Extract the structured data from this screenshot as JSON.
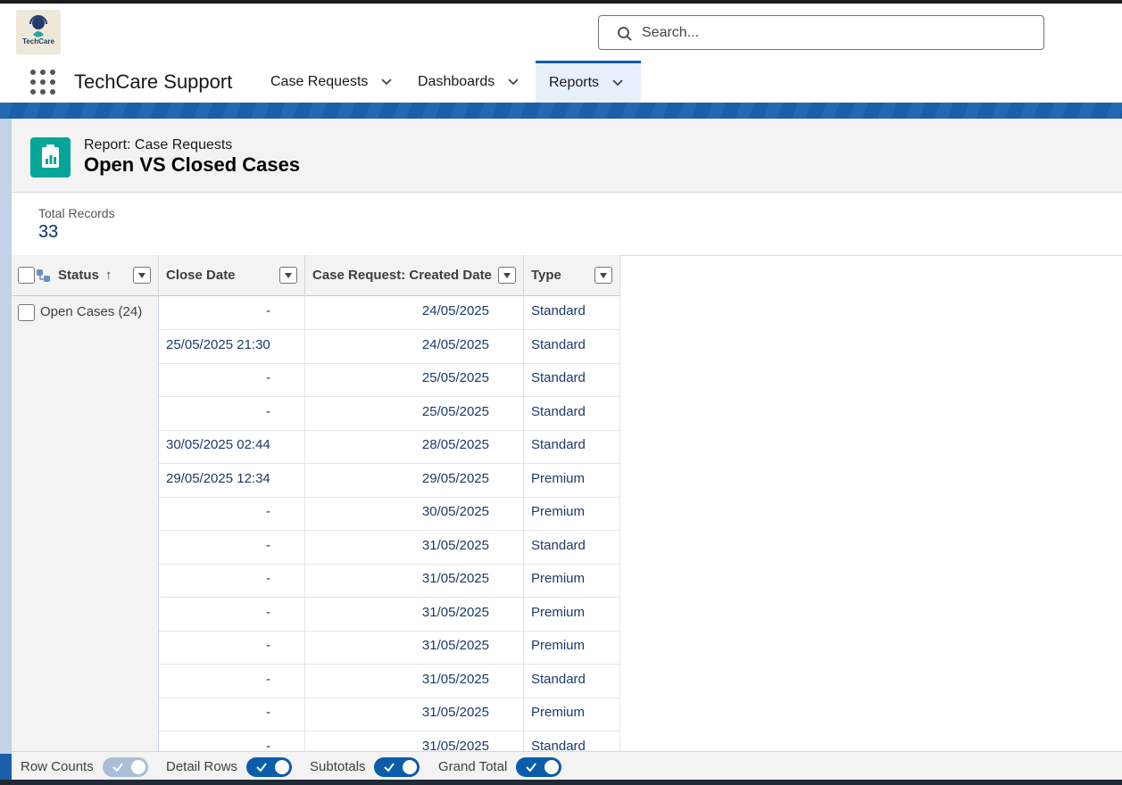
{
  "app": {
    "logo_text": "TechCare",
    "name": "TechCare Support"
  },
  "search": {
    "placeholder": "Search..."
  },
  "nav": {
    "tabs": [
      {
        "label": "Case Requests",
        "active": false
      },
      {
        "label": "Dashboards",
        "active": false
      },
      {
        "label": "Reports",
        "active": true
      }
    ]
  },
  "report": {
    "subtitle": "Report: Case Requests",
    "title": "Open VS Closed Cases",
    "total_label": "Total Records",
    "total_value": "33"
  },
  "table": {
    "columns": {
      "status": "Status",
      "sort_arrow": "↑",
      "close_date": "Close Date",
      "created_date": "Case Request: Created Date",
      "type": "Type"
    },
    "group_label": "Open Cases (24)",
    "rows": [
      {
        "close": "-",
        "created": "24/05/2025",
        "type": "Standard"
      },
      {
        "close": "25/05/2025 21:30",
        "created": "24/05/2025",
        "type": "Standard"
      },
      {
        "close": "-",
        "created": "25/05/2025",
        "type": "Standard"
      },
      {
        "close": "-",
        "created": "25/05/2025",
        "type": "Standard"
      },
      {
        "close": "30/05/2025 02:44",
        "created": "28/05/2025",
        "type": "Standard"
      },
      {
        "close": "29/05/2025 12:34",
        "created": "29/05/2025",
        "type": "Premium"
      },
      {
        "close": "-",
        "created": "30/05/2025",
        "type": "Premium"
      },
      {
        "close": "-",
        "created": "31/05/2025",
        "type": "Standard"
      },
      {
        "close": "-",
        "created": "31/05/2025",
        "type": "Premium"
      },
      {
        "close": "-",
        "created": "31/05/2025",
        "type": "Premium"
      },
      {
        "close": "-",
        "created": "31/05/2025",
        "type": "Premium"
      },
      {
        "close": "-",
        "created": "31/05/2025",
        "type": "Standard"
      },
      {
        "close": "-",
        "created": "31/05/2025",
        "type": "Premium"
      },
      {
        "close": "-",
        "created": "31/05/2025",
        "type": "Standard"
      }
    ]
  },
  "footer": {
    "row_counts": {
      "label": "Row Counts",
      "on": false
    },
    "detail_rows": {
      "label": "Detail Rows",
      "on": true
    },
    "subtotals": {
      "label": "Subtotals",
      "on": true
    },
    "grand_total": {
      "label": "Grand Total",
      "on": true
    }
  },
  "colors": {
    "brand_blue": "#0b5cab",
    "report_icon": "#06a59a"
  }
}
